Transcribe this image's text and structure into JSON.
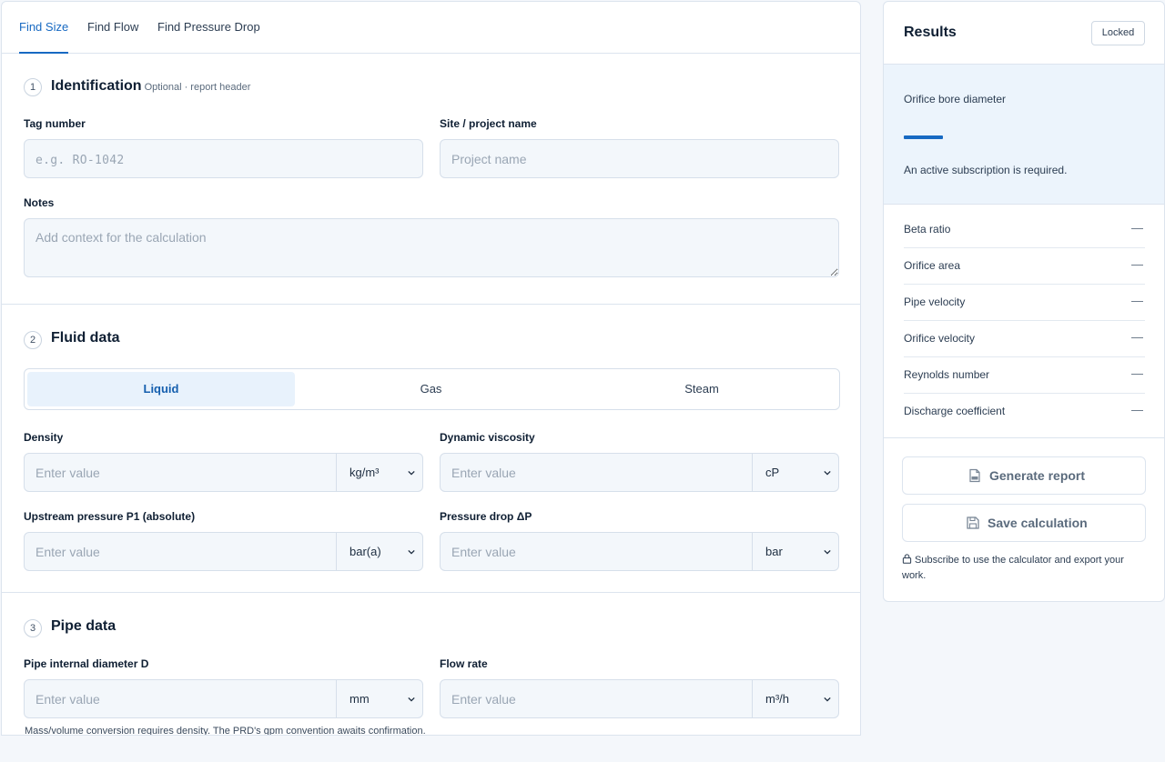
{
  "tabs": [
    {
      "label": "Find Size",
      "active": true
    },
    {
      "label": "Find Flow",
      "active": false
    },
    {
      "label": "Find Pressure Drop",
      "active": false
    }
  ],
  "sections": {
    "identification": {
      "number": "1",
      "title": "Identification",
      "subtitle": "Optional · report header",
      "tag_label": "Tag number",
      "tag_placeholder": "e.g. RO-1042",
      "site_label": "Site / project name",
      "site_placeholder": "Project name",
      "notes_label": "Notes",
      "notes_placeholder": "Add context for the calculation"
    },
    "fluid": {
      "number": "2",
      "title": "Fluid data",
      "phases": [
        {
          "label": "Liquid",
          "active": true
        },
        {
          "label": "Gas",
          "active": false
        },
        {
          "label": "Steam",
          "active": false
        }
      ],
      "density_label": "Density",
      "density_unit": "kg/m³",
      "viscosity_label": "Dynamic viscosity",
      "viscosity_unit": "cP",
      "p1_label": "Upstream pressure P1 (absolute)",
      "p1_unit": "bar(a)",
      "dp_label": "Pressure drop ΔP",
      "dp_unit": "bar",
      "value_placeholder": "Enter value"
    },
    "pipe": {
      "number": "3",
      "title": "Pipe data",
      "diameter_label": "Pipe internal diameter D",
      "diameter_unit": "mm",
      "flow_label": "Flow rate",
      "flow_unit": "m³/h",
      "value_placeholder": "Enter value",
      "note": "Mass/volume conversion requires density. The PRD's gpm convention awaits confirmation."
    }
  },
  "results": {
    "title": "Results",
    "status_badge": "Locked",
    "primary_label": "Orifice bore diameter",
    "subscription_message": "An active subscription is required.",
    "rows": [
      {
        "label": "Beta ratio",
        "value": "—"
      },
      {
        "label": "Orifice area",
        "value": "—"
      },
      {
        "label": "Pipe velocity",
        "value": "—"
      },
      {
        "label": "Orifice velocity",
        "value": "—"
      },
      {
        "label": "Reynolds number",
        "value": "—"
      },
      {
        "label": "Discharge coefficient",
        "value": "—"
      }
    ],
    "generate_report_label": "Generate report",
    "save_label": "Save calculation",
    "footer_message": "Subscribe to use the calculator and export your work."
  },
  "icons": {
    "report": "pdf-file-icon",
    "save": "floppy-disk-icon",
    "lock": "lock-icon",
    "chevron": "chevron-down-icon"
  },
  "colors": {
    "accent": "#1769c2",
    "highlight_bg": "#ecf4fc",
    "field_bg": "#f3f7fb"
  }
}
